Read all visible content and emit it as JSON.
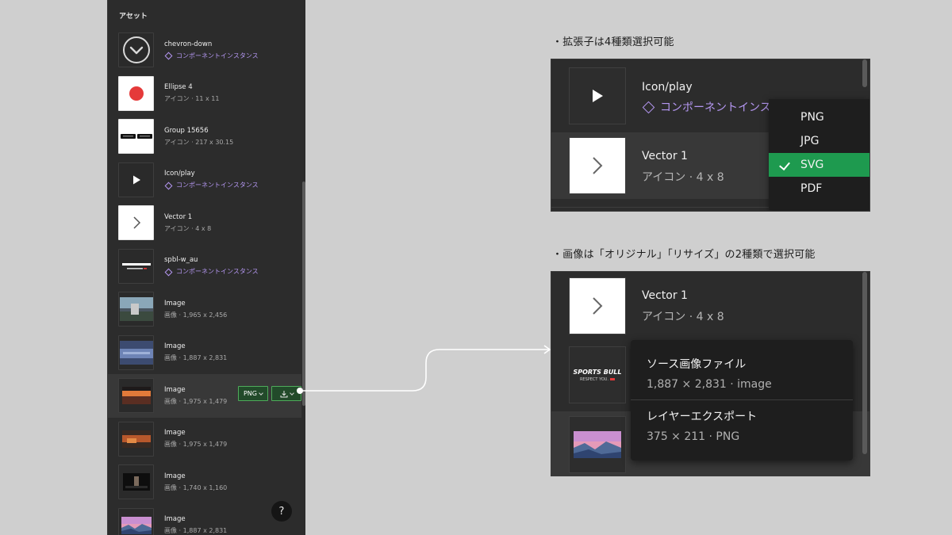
{
  "panel": {
    "title": "アセット",
    "items": [
      {
        "name": "chevron-down",
        "meta": "コンポーネントインスタンス",
        "kind": "instance",
        "thumb": "chevron-circle"
      },
      {
        "name": "Ellipse 4",
        "meta": "アイコン · 11 x 11",
        "kind": "icon",
        "thumb": "red-circle"
      },
      {
        "name": "Group 15656",
        "meta": "アイコン · 217 x 30.15",
        "kind": "icon",
        "thumb": "store-badges"
      },
      {
        "name": "Icon/play",
        "meta": "コンポーネントインスタンス",
        "kind": "instance",
        "thumb": "play"
      },
      {
        "name": "Vector 1",
        "meta": "アイコン · 4 x 8",
        "kind": "icon",
        "thumb": "chevron-right"
      },
      {
        "name": "spbl-w_au",
        "meta": "コンポーネントインスタンス",
        "kind": "instance",
        "thumb": "sportsbull-logo"
      },
      {
        "name": "Image",
        "meta": "画像 · 1,965 x 2,456",
        "kind": "image",
        "thumb": "photo-stadium"
      },
      {
        "name": "Image",
        "meta": "画像 · 1,887 x 2,831",
        "kind": "image",
        "thumb": "photo-blue"
      },
      {
        "name": "Image",
        "meta": "画像 · 1,975 x 1,479",
        "kind": "image",
        "thumb": "photo-sunset"
      },
      {
        "name": "Image",
        "meta": "画像 · 1,975 x 1,479",
        "kind": "image",
        "thumb": "photo-orange"
      },
      {
        "name": "Image",
        "meta": "画像 · 1,740 x 1,160",
        "kind": "image",
        "thumb": "photo-dark"
      },
      {
        "name": "Image",
        "meta": "画像 · 1,887 x 2,831",
        "kind": "image",
        "thumb": "photo-mountain"
      }
    ],
    "hovered_format": "PNG",
    "help_label": "?"
  },
  "callout_formats": {
    "caption": "・拡張子は4種類選択可能",
    "rows": [
      {
        "name": "Icon/play",
        "meta": "コンポーネントインスタンス"
      },
      {
        "name": "Vector 1",
        "meta": "アイコン · 4 x 8"
      }
    ],
    "formats": [
      "PNG",
      "JPG",
      "SVG",
      "PDF"
    ],
    "selected_format": "SVG"
  },
  "callout_images": {
    "caption": "・画像は「オリジナル」「リサイズ」の2種類で選択可能",
    "row": {
      "name": "Vector 1",
      "meta": "アイコン · 4 x 8"
    },
    "logo_text": "SPORTS BULL",
    "logo_sub": "RESPECT YOU.",
    "options": [
      {
        "title": "ソース画像ファイル",
        "sub": "1,887 × 2,831 · image"
      },
      {
        "title": "レイヤーエクスポート",
        "sub": "375 × 211 · PNG"
      }
    ]
  },
  "colors": {
    "panel_bg": "#2c2c2c",
    "instance_purple": "#b597f2",
    "selected_green": "#1e9a4f",
    "page_bg": "#cfcfcf"
  }
}
